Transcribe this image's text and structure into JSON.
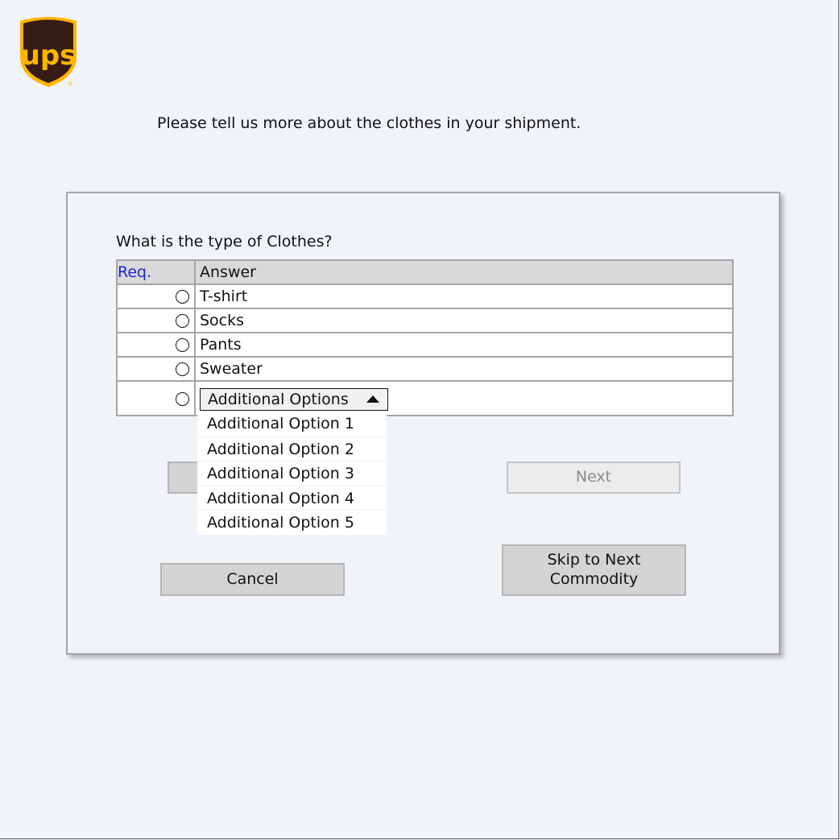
{
  "logo": {
    "text": "ups",
    "colors": {
      "shield": "#351c15",
      "letters": "#ffb500"
    }
  },
  "intro_text": "Please tell us more about the clothes in your shipment.",
  "form": {
    "question": "What is the type of Clothes?",
    "table": {
      "headers": {
        "req": "Req.",
        "answer": "Answer"
      },
      "rows": [
        {
          "answer": "T-shirt"
        },
        {
          "answer": "Socks"
        },
        {
          "answer": "Pants"
        },
        {
          "answer": "Sweater"
        }
      ]
    },
    "select": {
      "selected": "Additional Options",
      "options": [
        "Additional Option 1",
        "Additional Option 2",
        "Additional Option 3",
        "Additional Option 4",
        "Additional Option 5"
      ]
    },
    "buttons": {
      "back": "",
      "next": "Next",
      "cancel": "Cancel",
      "skip_line1": "Skip to Next",
      "skip_line2": "Commodity"
    }
  },
  "colors": {
    "background": "#f0f3f8",
    "req_header": "#1a24d6",
    "header_bg": "#d9d9d9",
    "button_bg": "#d4d4d4",
    "disabled_text": "#8a8a8a"
  }
}
